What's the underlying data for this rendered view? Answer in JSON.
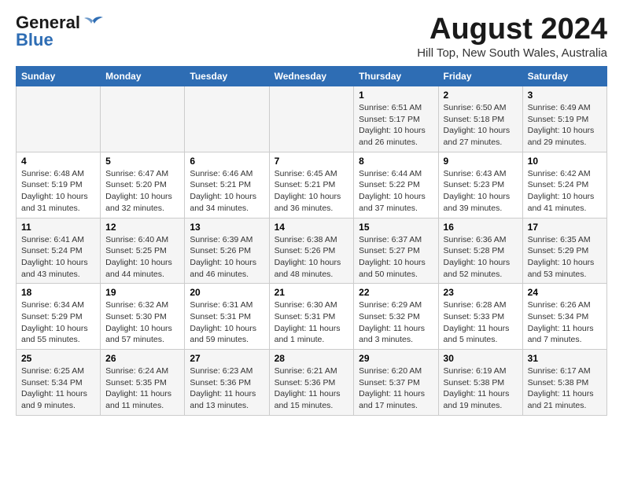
{
  "header": {
    "logo_line1": "General",
    "logo_line2": "Blue",
    "title": "August 2024",
    "subtitle": "Hill Top, New South Wales, Australia"
  },
  "days_of_week": [
    "Sunday",
    "Monday",
    "Tuesday",
    "Wednesday",
    "Thursday",
    "Friday",
    "Saturday"
  ],
  "weeks": [
    [
      {
        "day": "",
        "info": ""
      },
      {
        "day": "",
        "info": ""
      },
      {
        "day": "",
        "info": ""
      },
      {
        "day": "",
        "info": ""
      },
      {
        "day": "1",
        "info": "Sunrise: 6:51 AM\nSunset: 5:17 PM\nDaylight: 10 hours\nand 26 minutes."
      },
      {
        "day": "2",
        "info": "Sunrise: 6:50 AM\nSunset: 5:18 PM\nDaylight: 10 hours\nand 27 minutes."
      },
      {
        "day": "3",
        "info": "Sunrise: 6:49 AM\nSunset: 5:19 PM\nDaylight: 10 hours\nand 29 minutes."
      }
    ],
    [
      {
        "day": "4",
        "info": "Sunrise: 6:48 AM\nSunset: 5:19 PM\nDaylight: 10 hours\nand 31 minutes."
      },
      {
        "day": "5",
        "info": "Sunrise: 6:47 AM\nSunset: 5:20 PM\nDaylight: 10 hours\nand 32 minutes."
      },
      {
        "day": "6",
        "info": "Sunrise: 6:46 AM\nSunset: 5:21 PM\nDaylight: 10 hours\nand 34 minutes."
      },
      {
        "day": "7",
        "info": "Sunrise: 6:45 AM\nSunset: 5:21 PM\nDaylight: 10 hours\nand 36 minutes."
      },
      {
        "day": "8",
        "info": "Sunrise: 6:44 AM\nSunset: 5:22 PM\nDaylight: 10 hours\nand 37 minutes."
      },
      {
        "day": "9",
        "info": "Sunrise: 6:43 AM\nSunset: 5:23 PM\nDaylight: 10 hours\nand 39 minutes."
      },
      {
        "day": "10",
        "info": "Sunrise: 6:42 AM\nSunset: 5:24 PM\nDaylight: 10 hours\nand 41 minutes."
      }
    ],
    [
      {
        "day": "11",
        "info": "Sunrise: 6:41 AM\nSunset: 5:24 PM\nDaylight: 10 hours\nand 43 minutes."
      },
      {
        "day": "12",
        "info": "Sunrise: 6:40 AM\nSunset: 5:25 PM\nDaylight: 10 hours\nand 44 minutes."
      },
      {
        "day": "13",
        "info": "Sunrise: 6:39 AM\nSunset: 5:26 PM\nDaylight: 10 hours\nand 46 minutes."
      },
      {
        "day": "14",
        "info": "Sunrise: 6:38 AM\nSunset: 5:26 PM\nDaylight: 10 hours\nand 48 minutes."
      },
      {
        "day": "15",
        "info": "Sunrise: 6:37 AM\nSunset: 5:27 PM\nDaylight: 10 hours\nand 50 minutes."
      },
      {
        "day": "16",
        "info": "Sunrise: 6:36 AM\nSunset: 5:28 PM\nDaylight: 10 hours\nand 52 minutes."
      },
      {
        "day": "17",
        "info": "Sunrise: 6:35 AM\nSunset: 5:29 PM\nDaylight: 10 hours\nand 53 minutes."
      }
    ],
    [
      {
        "day": "18",
        "info": "Sunrise: 6:34 AM\nSunset: 5:29 PM\nDaylight: 10 hours\nand 55 minutes."
      },
      {
        "day": "19",
        "info": "Sunrise: 6:32 AM\nSunset: 5:30 PM\nDaylight: 10 hours\nand 57 minutes."
      },
      {
        "day": "20",
        "info": "Sunrise: 6:31 AM\nSunset: 5:31 PM\nDaylight: 10 hours\nand 59 minutes."
      },
      {
        "day": "21",
        "info": "Sunrise: 6:30 AM\nSunset: 5:31 PM\nDaylight: 11 hours\nand 1 minute."
      },
      {
        "day": "22",
        "info": "Sunrise: 6:29 AM\nSunset: 5:32 PM\nDaylight: 11 hours\nand 3 minutes."
      },
      {
        "day": "23",
        "info": "Sunrise: 6:28 AM\nSunset: 5:33 PM\nDaylight: 11 hours\nand 5 minutes."
      },
      {
        "day": "24",
        "info": "Sunrise: 6:26 AM\nSunset: 5:34 PM\nDaylight: 11 hours\nand 7 minutes."
      }
    ],
    [
      {
        "day": "25",
        "info": "Sunrise: 6:25 AM\nSunset: 5:34 PM\nDaylight: 11 hours\nand 9 minutes."
      },
      {
        "day": "26",
        "info": "Sunrise: 6:24 AM\nSunset: 5:35 PM\nDaylight: 11 hours\nand 11 minutes."
      },
      {
        "day": "27",
        "info": "Sunrise: 6:23 AM\nSunset: 5:36 PM\nDaylight: 11 hours\nand 13 minutes."
      },
      {
        "day": "28",
        "info": "Sunrise: 6:21 AM\nSunset: 5:36 PM\nDaylight: 11 hours\nand 15 minutes."
      },
      {
        "day": "29",
        "info": "Sunrise: 6:20 AM\nSunset: 5:37 PM\nDaylight: 11 hours\nand 17 minutes."
      },
      {
        "day": "30",
        "info": "Sunrise: 6:19 AM\nSunset: 5:38 PM\nDaylight: 11 hours\nand 19 minutes."
      },
      {
        "day": "31",
        "info": "Sunrise: 6:17 AM\nSunset: 5:38 PM\nDaylight: 11 hours\nand 21 minutes."
      }
    ]
  ]
}
